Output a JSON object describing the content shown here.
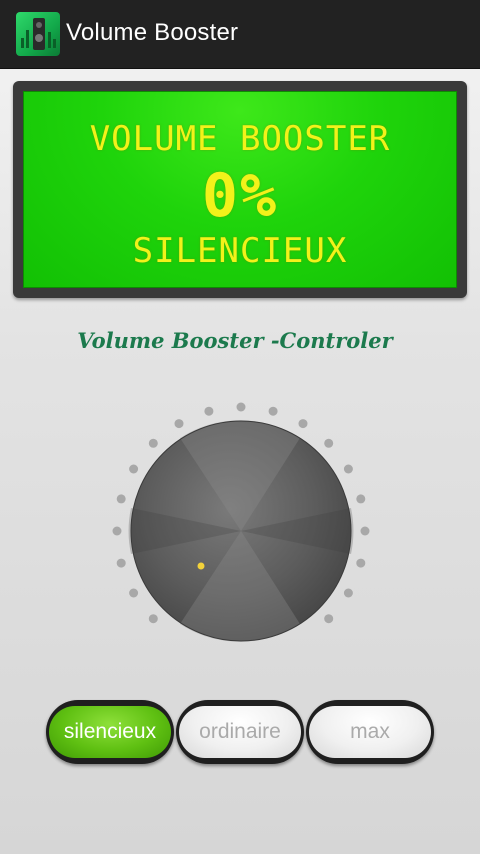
{
  "app_bar": {
    "title": "Volume Booster",
    "icon": "volume-booster-app-icon"
  },
  "display": {
    "line1": "VOLUME BOOSTER",
    "percent": "0%",
    "mode": "SILENCIEUX",
    "background_color": "#1fd40b",
    "text_color": "#f2f21a"
  },
  "controller": {
    "heading": "Volume Booster -Controler",
    "heading_color": "#1c7a4d",
    "knob_level_percent": 0,
    "tick_count": 19
  },
  "mode_buttons": [
    {
      "label": "silencieux",
      "active": true
    },
    {
      "label": "ordinaire",
      "active": false
    },
    {
      "label": "max",
      "active": false
    }
  ],
  "colors": {
    "accent_green": "#5fc012",
    "app_bar": "#222222"
  }
}
